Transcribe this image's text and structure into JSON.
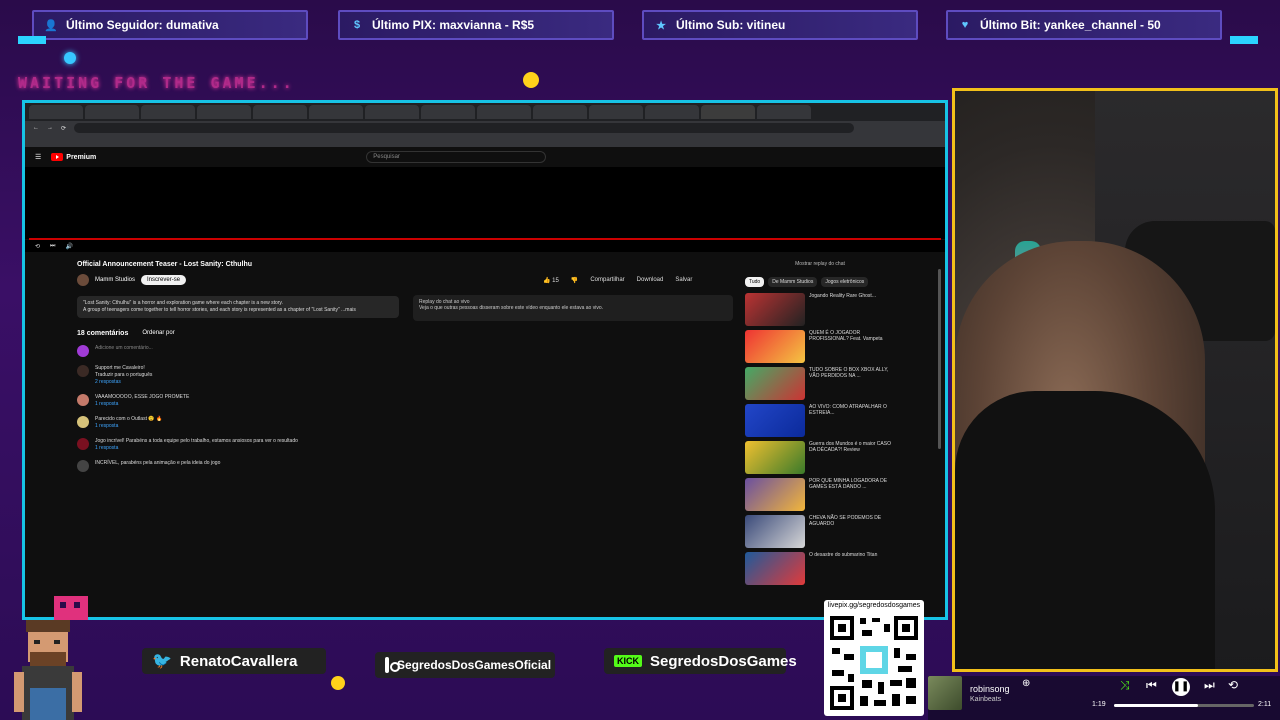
{
  "alerts": {
    "follower": "Último Seguidor: dumativa",
    "pix": "Último PIX: maxvianna - R$5",
    "sub": "Último Sub: vitineu",
    "bit": "Último Bit: yankee_channel - 50"
  },
  "waiting_text": "WAITING FOR THE GAME...",
  "browser": {
    "yt_logo": "Premium",
    "search_placeholder": "Pesquisar",
    "video_title": "Official Announcement Teaser - Lost Sanity: Cthulhu",
    "channel": "Mamm Studios",
    "subscribe": "Inscrever-se",
    "actions": {
      "like_count": "15",
      "share": "Compartilhar",
      "download": "Download",
      "save": "Salvar"
    },
    "description": [
      "\"Lost Sanity: Cthulhu\" is a horror and exploration game where each chapter is a new story.",
      "A group of teenagers come together to tell horror stories, and each story is represented as a chapter of \"Lost Sanity\"  ...mais"
    ],
    "chat_title": "Replay do chat ao vivo",
    "chat_text": "Veja o que outras pessoas disseram sobre este vídeo enquanto ele estava ao vivo.",
    "comments_header": "18 comentários",
    "sort_label": "Ordenar por",
    "add_comment": "Adicione um comentário...",
    "comments": [
      {
        "text": "Support me Cavaleiro!",
        "extra": "Traduzir para o português",
        "replies": "2 respostas"
      },
      {
        "text": "VAAAMOOOOO, ESSE JOGO PROMETE",
        "extra": "",
        "replies": "1 resposta"
      },
      {
        "text": "Parecido com o Outlast 😲 🔥",
        "extra": "",
        "replies": "1 resposta"
      },
      {
        "text": "Jogo incrível! Parabéns a toda equipe pelo trabalho, estamos ansiosos para ver o resultado",
        "extra": "",
        "replies": "1 resposta"
      },
      {
        "text": "INCRÍVEL, parabéns pela animação e pela ideia do jogo",
        "extra": "",
        "replies": ""
      }
    ],
    "side_header": "Mostrar replay do chat",
    "chips": [
      "Tudo",
      "De Mamm Studios",
      "Jogos eletrônicos"
    ],
    "recommendations": [
      "Jogando Reality Rare Ghost...",
      "QUEM É O JOGADOR PROFISSIONAL? Feat. Vampeta",
      "TUDO SOBRE O BOX XBOX ALLY, VÃO PERDIDOS NA ...",
      "AO VIVO: COMO ATRAPALHAR O ESTREIA...",
      "Guerra dos Mundos é o maior CASO DA DÉCADA?! Review",
      "POR QUE MINHA LOGADORA DE GAMES ESTÁ DANDO ...",
      "CHEVA NÃO SE PODEMOS DE AGUARDO",
      "O desastre do submarino Titan"
    ]
  },
  "social": {
    "twitter": "RenatoCavallera",
    "instagram": "SegredosDosGamesOficial",
    "kick_badge": "KICK",
    "kick": "SegredosDosGames",
    "qr_url": "livepix.gg/segredosdosgames"
  },
  "player": {
    "song": "robinsong",
    "artist": "Kainbeats",
    "time_current": "1:19",
    "time_total": "2:11",
    "progress": 0.6
  },
  "colors": {
    "frame": "#17c3e6",
    "webcam_border": "#f2c01a",
    "yt_red": "#ff0000"
  }
}
